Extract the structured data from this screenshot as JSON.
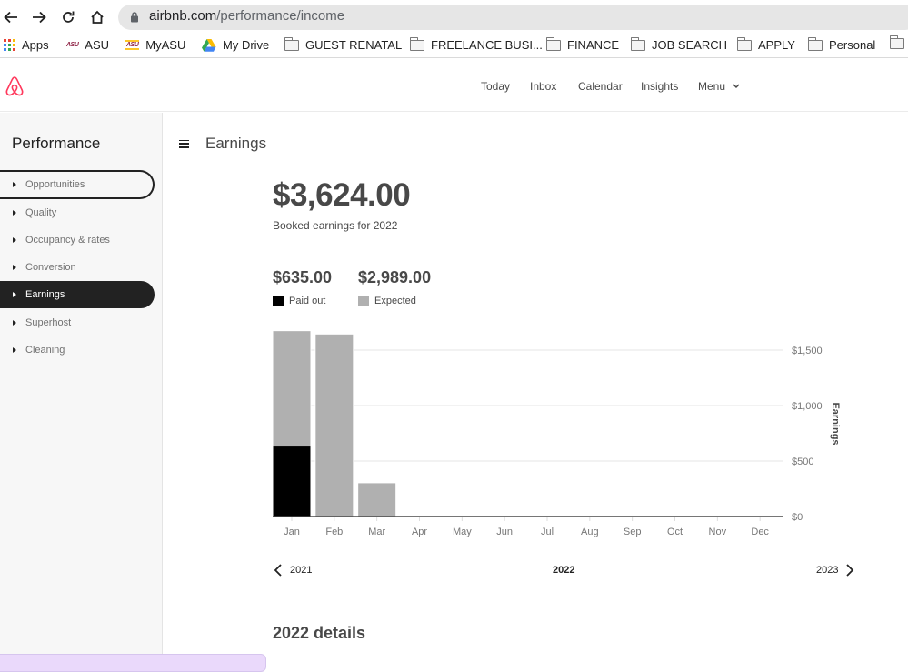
{
  "browser": {
    "url_domain": "airbnb.com",
    "url_path": "/performance/income",
    "bookmarks": [
      {
        "label": "Apps",
        "icon": "apps-grid-icon"
      },
      {
        "label": "ASU",
        "icon": "asu-logo-icon"
      },
      {
        "label": "MyASU",
        "icon": "myasu-logo-icon"
      },
      {
        "label": "My Drive",
        "icon": "google-drive-icon"
      },
      {
        "label": "GUEST RENATAL",
        "icon": "folder-icon"
      },
      {
        "label": "FREELANCE BUSI...",
        "icon": "folder-icon"
      },
      {
        "label": "FINANCE",
        "icon": "folder-icon"
      },
      {
        "label": "JOB SEARCH",
        "icon": "folder-icon"
      },
      {
        "label": "APPLY",
        "icon": "folder-icon"
      },
      {
        "label": "Personal",
        "icon": "folder-icon"
      }
    ]
  },
  "header": {
    "brand_color": "#ff385c",
    "nav": [
      {
        "label": "Today"
      },
      {
        "label": "Inbox"
      },
      {
        "label": "Calendar"
      },
      {
        "label": "Insights"
      },
      {
        "label": "Menu"
      }
    ]
  },
  "sidebar": {
    "title": "Performance",
    "items": [
      {
        "label": "Opportunities",
        "state": "focused"
      },
      {
        "label": "Quality",
        "state": ""
      },
      {
        "label": "Occupancy & rates",
        "state": ""
      },
      {
        "label": "Conversion",
        "state": ""
      },
      {
        "label": "Earnings",
        "state": "active"
      },
      {
        "label": "Superhost",
        "state": ""
      },
      {
        "label": "Cleaning",
        "state": ""
      }
    ]
  },
  "main": {
    "title": "Earnings",
    "total": "$3,624.00",
    "total_caption": "Booked earnings for 2022",
    "paid_out_amount": "$635.00",
    "paid_out_label": "Paid out",
    "expected_amount": "$2,989.00",
    "expected_label": "Expected",
    "prev_year": "2021",
    "current_year": "2022",
    "next_year": "2023",
    "details_title": "2022 details"
  },
  "chart_data": {
    "type": "bar",
    "stacked": true,
    "categories": [
      "Jan",
      "Feb",
      "Mar",
      "Apr",
      "May",
      "Jun",
      "Jul",
      "Aug",
      "Sep",
      "Oct",
      "Nov",
      "Dec"
    ],
    "series": [
      {
        "name": "Paid out",
        "color": "#000000",
        "values": [
          635,
          0,
          0,
          0,
          0,
          0,
          0,
          0,
          0,
          0,
          0,
          0
        ]
      },
      {
        "name": "Expected",
        "color": "#b0b0b0",
        "values": [
          1040,
          1645,
          304,
          0,
          0,
          0,
          0,
          0,
          0,
          0,
          0,
          0
        ]
      }
    ],
    "ylabel": "Earnings",
    "y_ticks": [
      0,
      500,
      1000,
      1500
    ],
    "y_tick_labels": [
      "$0",
      "$500",
      "$1,000",
      "$1,500"
    ],
    "ylim": [
      0,
      1700
    ],
    "grid": true,
    "y_axis_position": "right",
    "legend": "top-left"
  }
}
